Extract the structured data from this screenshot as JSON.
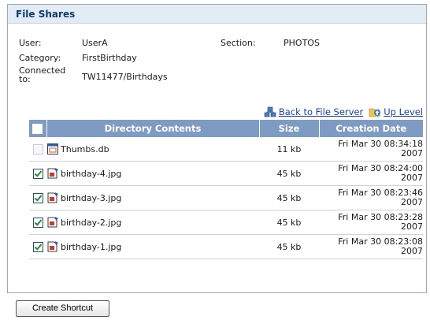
{
  "panel": {
    "title": "File Shares"
  },
  "info": {
    "user_label": "User:",
    "user_value": "UserA",
    "section_label": "Section:",
    "section_value": "PHOTOS",
    "category_label": "Category:",
    "category_value": "FirstBirthday",
    "connected_label_line1": "Connected",
    "connected_label_line2": "to:",
    "connected_value": "TW11477/Birthdays"
  },
  "links": {
    "back": "Back to File Server",
    "up": "Up Level"
  },
  "table": {
    "headers": [
      "Directory Contents",
      "Size",
      "Creation Date"
    ],
    "rows": [
      {
        "name": "Thumbs.db",
        "size": "11 kb",
        "date1": "Fri Mar 30 08:34:18",
        "date2": "2007",
        "checked": false,
        "disabled": true,
        "icon": "db-file-icon"
      },
      {
        "name": "birthday-4.jpg",
        "size": "45 kb",
        "date1": "Fri Mar 30 08:24:00",
        "date2": "2007",
        "checked": true,
        "disabled": false,
        "icon": "image-file-icon"
      },
      {
        "name": "birthday-3.jpg",
        "size": "45 kb",
        "date1": "Fri Mar 30 08:23:46",
        "date2": "2007",
        "checked": true,
        "disabled": false,
        "icon": "image-file-icon"
      },
      {
        "name": "birthday-2.jpg",
        "size": "45 kb",
        "date1": "Fri Mar 30 08:23:28",
        "date2": "2007",
        "checked": true,
        "disabled": false,
        "icon": "image-file-icon"
      },
      {
        "name": "birthday-1.jpg",
        "size": "45 kb",
        "date1": "Fri Mar 30 08:23:08",
        "date2": "2007",
        "checked": true,
        "disabled": false,
        "icon": "image-file-icon"
      }
    ]
  },
  "actions": {
    "create_shortcut": "Create Shortcut"
  },
  "colors": {
    "header_bg": "#7e9bc4",
    "panel_header_bg": "#e3ebf5",
    "link": "#1b3fb8"
  }
}
